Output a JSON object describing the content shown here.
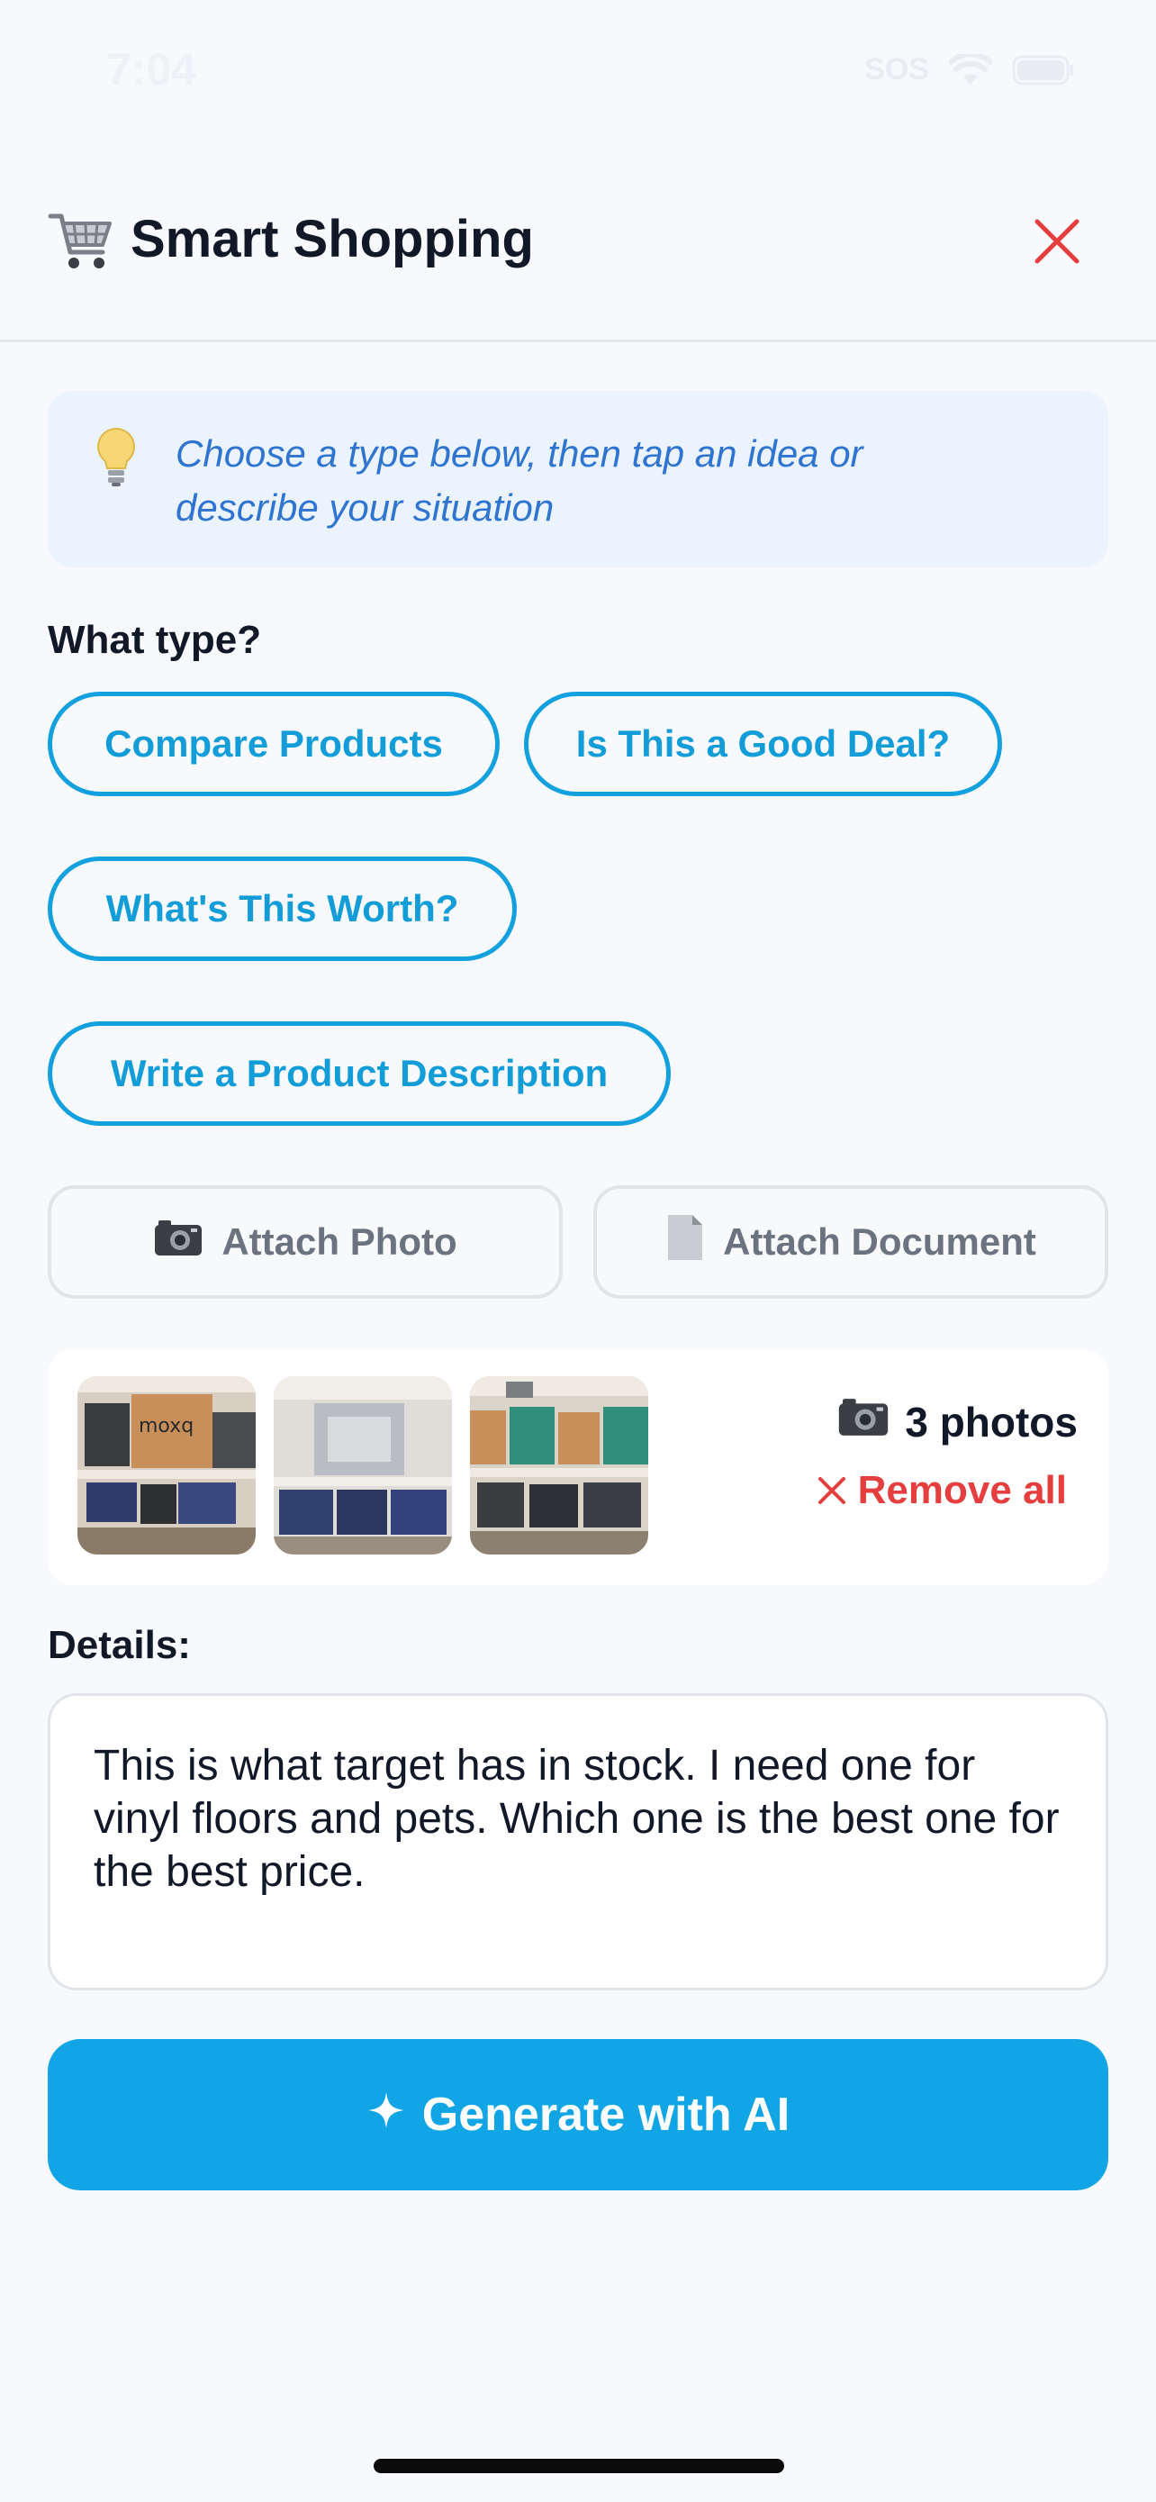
{
  "status_bar": {
    "time": "7:04",
    "sos": "SOS"
  },
  "header": {
    "icon": "shopping-cart-icon",
    "title": "Smart Shopping",
    "close_icon": "close-icon"
  },
  "tip": {
    "icon": "lightbulb-icon",
    "text": "Choose a type below, then tap an idea or describe your situation"
  },
  "type_section": {
    "label": "What type?",
    "options": [
      "Compare Products",
      "Is This a Good Deal?",
      "What's This Worth?",
      "Write a Product Description"
    ]
  },
  "attach": {
    "photo_label": "Attach Photo",
    "photo_icon": "camera-icon",
    "document_label": "Attach Document",
    "document_icon": "document-icon"
  },
  "photos": {
    "count_label": "3 photos",
    "remove_label": "Remove all",
    "thumbnails": [
      "photo-1",
      "photo-2",
      "photo-3"
    ]
  },
  "details": {
    "label": "Details:",
    "value": "This is what target has in stock. I need one for vinyl floors and pets. Which one is the best one for the best price."
  },
  "generate_button": {
    "label": "Generate with AI",
    "icon": "sparkle-icon"
  },
  "colors": {
    "accent": "#12a5e6",
    "chip_border": "#12a0de",
    "danger": "#e53e3e",
    "tip_bg": "#eaf3fe",
    "tip_text": "#2f74d0",
    "page_bg": "#f7f9fc"
  }
}
